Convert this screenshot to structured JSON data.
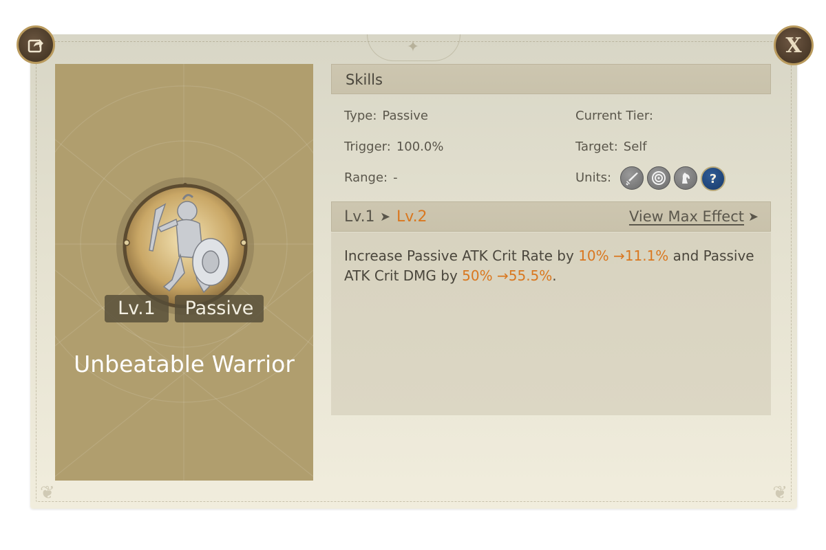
{
  "header": {
    "close_label": "X"
  },
  "skill": {
    "level_badge": "Lv.1",
    "type_badge": "Passive",
    "name": "Unbeatable Warrior"
  },
  "skills_section": {
    "title": "Skills",
    "type_label": "Type:",
    "type_value": "Passive",
    "current_tier_label": "Current Tier:",
    "trigger_label": "Trigger:",
    "trigger_value": "100.0%",
    "target_label": "Target:",
    "target_value": "Self",
    "range_label": "Range:",
    "range_value": "-",
    "units_label": "Units:",
    "unit_icons": [
      "sword-icon",
      "target-icon",
      "horse-icon",
      "question-icon"
    ],
    "question_glyph": "?"
  },
  "level_section": {
    "from": "Lv.1",
    "arrow": "➤",
    "to": "Lv.2",
    "view_max": "View Max Effect",
    "view_max_arrow": "➤"
  },
  "effect": {
    "p1": "Increase Passive ATK Crit Rate by ",
    "h1": "10% →11.1%",
    "p2": " and Passive ATK Crit DMG by ",
    "h2": "50% →55.5%",
    "p3": "."
  },
  "colors": {
    "accent": "#d9771f",
    "card": "#b09e6e",
    "text": "#4a463c"
  }
}
